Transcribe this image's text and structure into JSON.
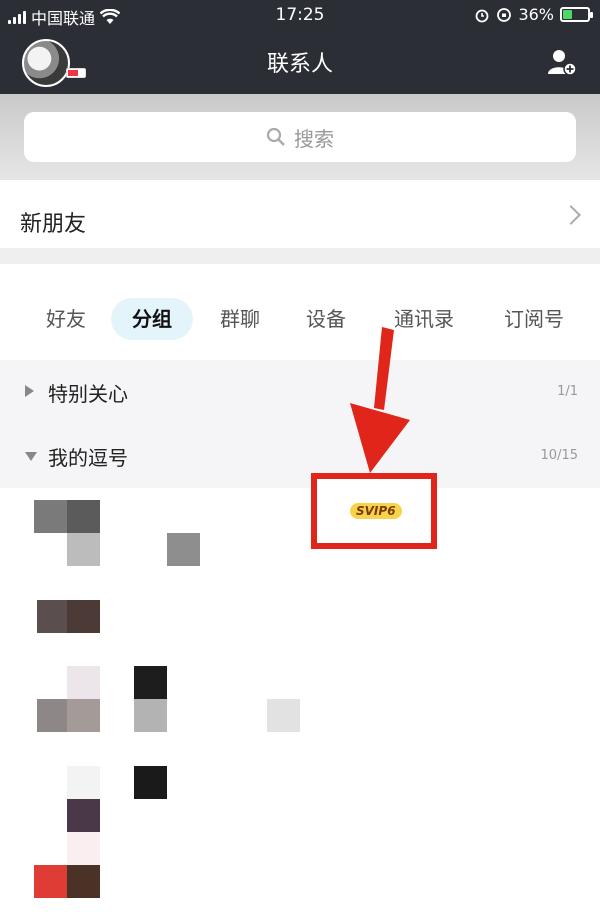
{
  "status_bar": {
    "carrier": "中国联通",
    "time": "17:25",
    "battery": "36%",
    "battery_level": 0.36
  },
  "nav": {
    "title": "联系人"
  },
  "search": {
    "placeholder": "搜索"
  },
  "new_friends": {
    "label": "新朋友"
  },
  "tabs": [
    {
      "label": "好友",
      "active": false
    },
    {
      "label": "分组",
      "active": true
    },
    {
      "label": "群聊",
      "active": false
    },
    {
      "label": "设备",
      "active": false
    },
    {
      "label": "通讯录",
      "active": false
    },
    {
      "label": "订阅号",
      "active": false
    }
  ],
  "groups": [
    {
      "name": "特别关心",
      "count": "1/1",
      "expanded": false
    },
    {
      "name": "我的逗号",
      "count": "10/15",
      "expanded": true
    }
  ],
  "annotation": {
    "badge": "SVIP6",
    "highlight_color": "#e0261b"
  }
}
